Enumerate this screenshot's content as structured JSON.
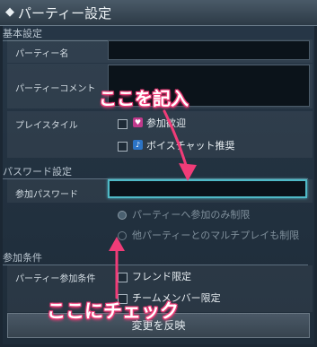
{
  "window": {
    "title": "パーティー設定",
    "title_icon": "diamond-icon"
  },
  "basic": {
    "heading": "基本設定",
    "party_name_label": "パーティー名",
    "party_name_value": "",
    "party_comment_label": "パーティーコメント",
    "party_comment_value": "",
    "play_style_label": "プレイスタイル",
    "play_style_options": [
      {
        "text": "参加歓迎",
        "checked": false,
        "icon": "welcome-icon",
        "color": "#c0398b"
      },
      {
        "text": "ボイスチャット推奨",
        "checked": false,
        "icon": "voice-chat-icon",
        "color": "#2c74c6"
      }
    ]
  },
  "password": {
    "heading": "パスワード設定",
    "label": "参加パスワード",
    "value": "",
    "radios": [
      {
        "text": "パーティーへ参加のみ制限",
        "selected": true
      },
      {
        "text": "他パーティーとのマルチプレイも制限",
        "selected": false
      }
    ]
  },
  "conditions": {
    "heading": "参加条件",
    "label": "パーティー参加条件",
    "options": [
      {
        "text": "フレンド限定",
        "checked": false
      },
      {
        "text": "チームメンバー限定",
        "checked": false
      }
    ]
  },
  "apply_button": "変更を反映",
  "annotations": {
    "enter_here": "ここを記入",
    "check_here": "ここにチェック",
    "color": "#f03c78"
  }
}
